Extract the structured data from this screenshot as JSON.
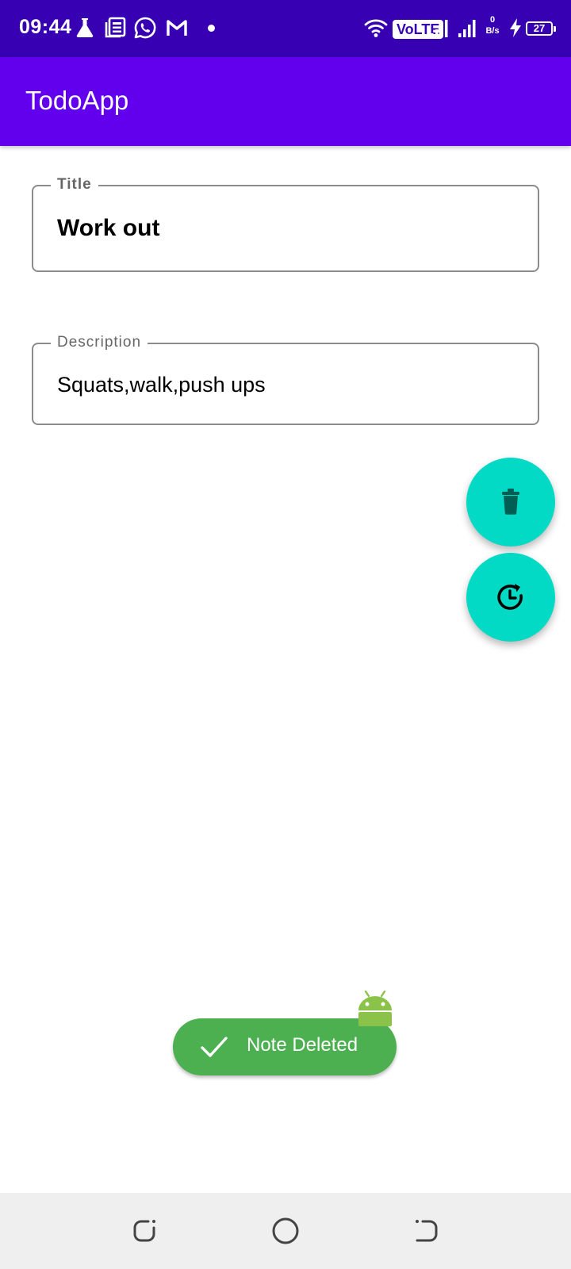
{
  "status_bar": {
    "time": "09:44",
    "network_type": "VoLTE",
    "speed_value": "0",
    "speed_unit": "B/s",
    "battery": "27",
    "icons": [
      "flask-icon",
      "news-icon",
      "whatsapp-icon",
      "gmail-icon",
      "notification-dot",
      "wifi-icon",
      "signal-icon-1",
      "signal-icon-2",
      "charging-icon",
      "battery-icon"
    ]
  },
  "app_bar": {
    "title": "TodoApp"
  },
  "form": {
    "title_label": "Title",
    "title_value": "Work out",
    "description_label": "Description",
    "description_value": "Squats,walk,push ups"
  },
  "fabs": {
    "delete_icon": "trash-icon",
    "restore_icon": "history-icon",
    "color": "#03dac5"
  },
  "toast": {
    "message": "Note Deleted",
    "icon": "check-icon",
    "color": "#4caf50"
  },
  "nav_bar": {
    "buttons": [
      "back-icon",
      "home-icon",
      "recents-icon"
    ]
  },
  "colors": {
    "status_bar": "#3700b3",
    "app_bar": "#6200ee",
    "nav_bar": "#efefef"
  }
}
